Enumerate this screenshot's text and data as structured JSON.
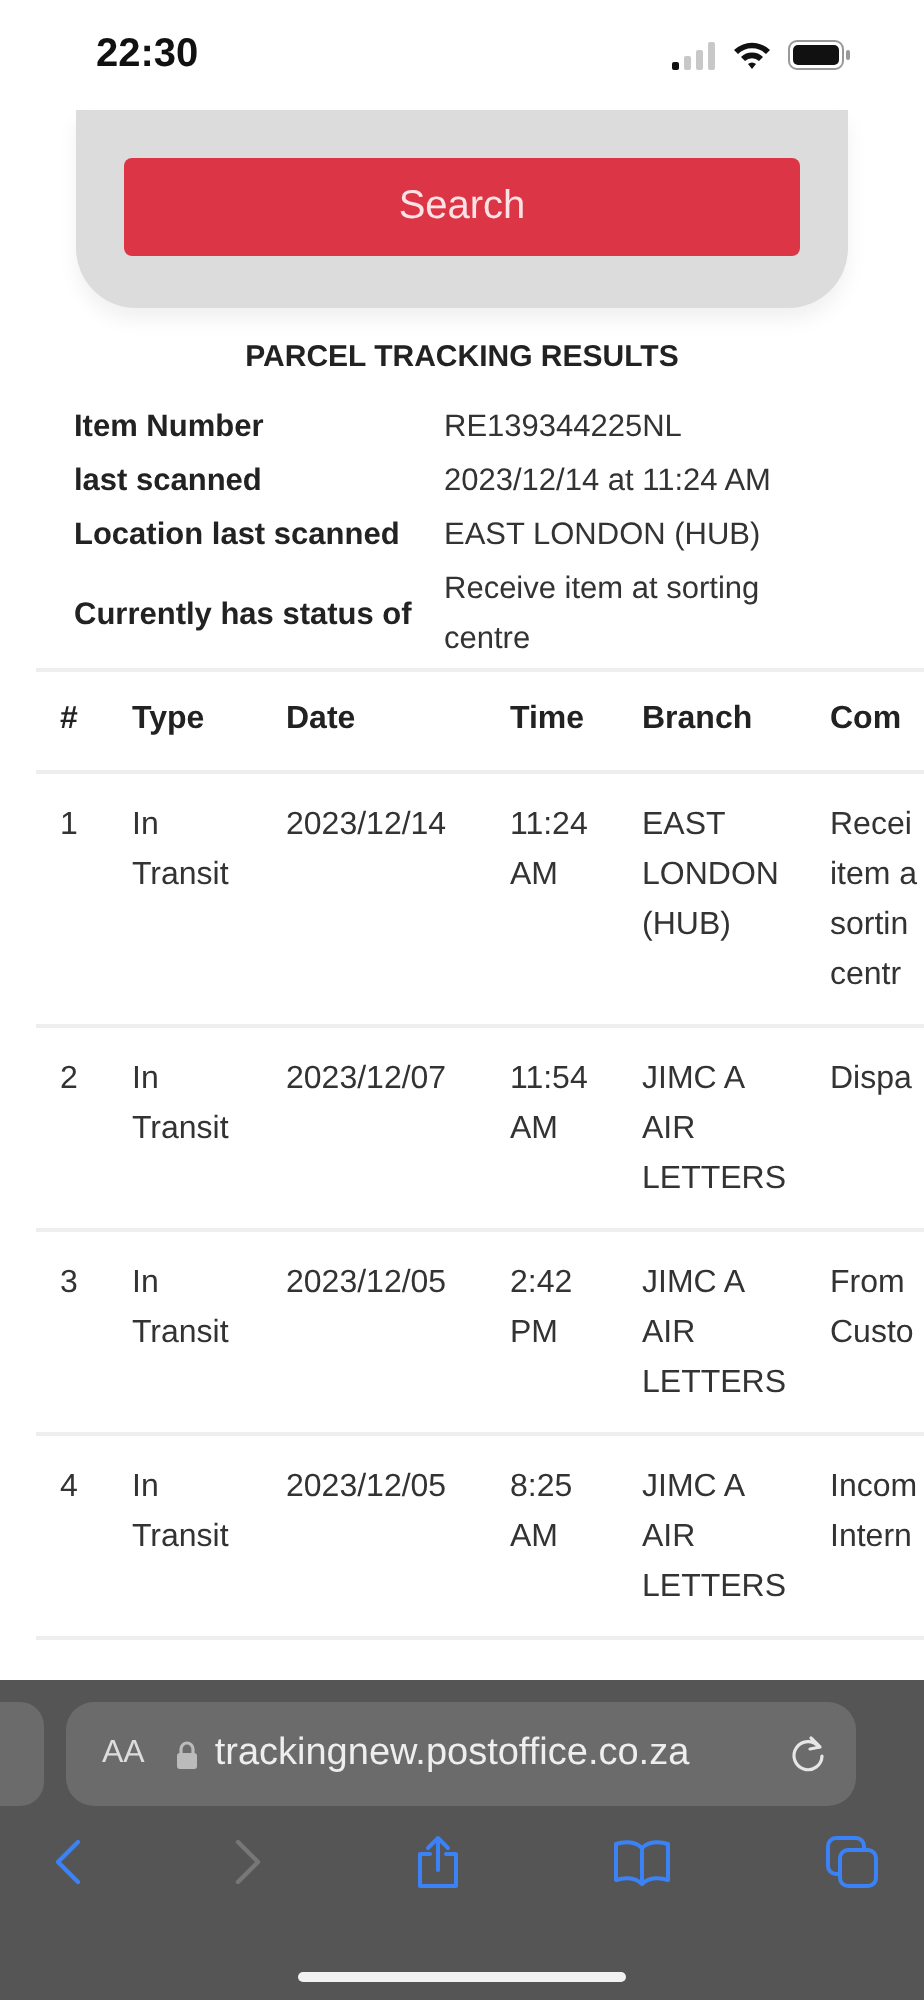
{
  "status_bar": {
    "time": "22:30"
  },
  "search_card": {
    "button": "Search"
  },
  "results": {
    "title": "PARCEL TRACKING RESULTS",
    "details": [
      {
        "label": "Item Number",
        "value": "RE139344225NL"
      },
      {
        "label": "last scanned",
        "value": "2023/12/14 at 11:24 AM"
      },
      {
        "label": "Location last scanned",
        "value": "EAST LONDON (HUB)"
      },
      {
        "label": "Currently has status of",
        "value": "Receive item at sorting centre"
      }
    ]
  },
  "table": {
    "columns": [
      "#",
      "Type",
      "Date",
      "Time",
      "Branch",
      "Com"
    ],
    "rows": [
      {
        "cells": [
          "1",
          "In Transit",
          "2023/12/14",
          "11:24 AM",
          "EAST LONDON (HUB)",
          "Recei\nitem a\nsortin\ncentr"
        ]
      },
      {
        "cells": [
          "2",
          "In Transit",
          "2023/12/07",
          "11:54 AM",
          "JIMC A AIR LETTERS",
          "Dispa"
        ]
      },
      {
        "cells": [
          "3",
          "In Transit",
          "2023/12/05",
          "2:42 PM",
          "JIMC A AIR LETTERS",
          "From\nCusto"
        ]
      },
      {
        "cells": [
          "4",
          "In Transit",
          "2023/12/05",
          "8:25 AM",
          "JIMC A AIR LETTERS",
          "Incom\nIntern"
        ]
      }
    ]
  },
  "browser": {
    "text_size": "AA",
    "url": "trackingnew.postoffice.co.za"
  }
}
